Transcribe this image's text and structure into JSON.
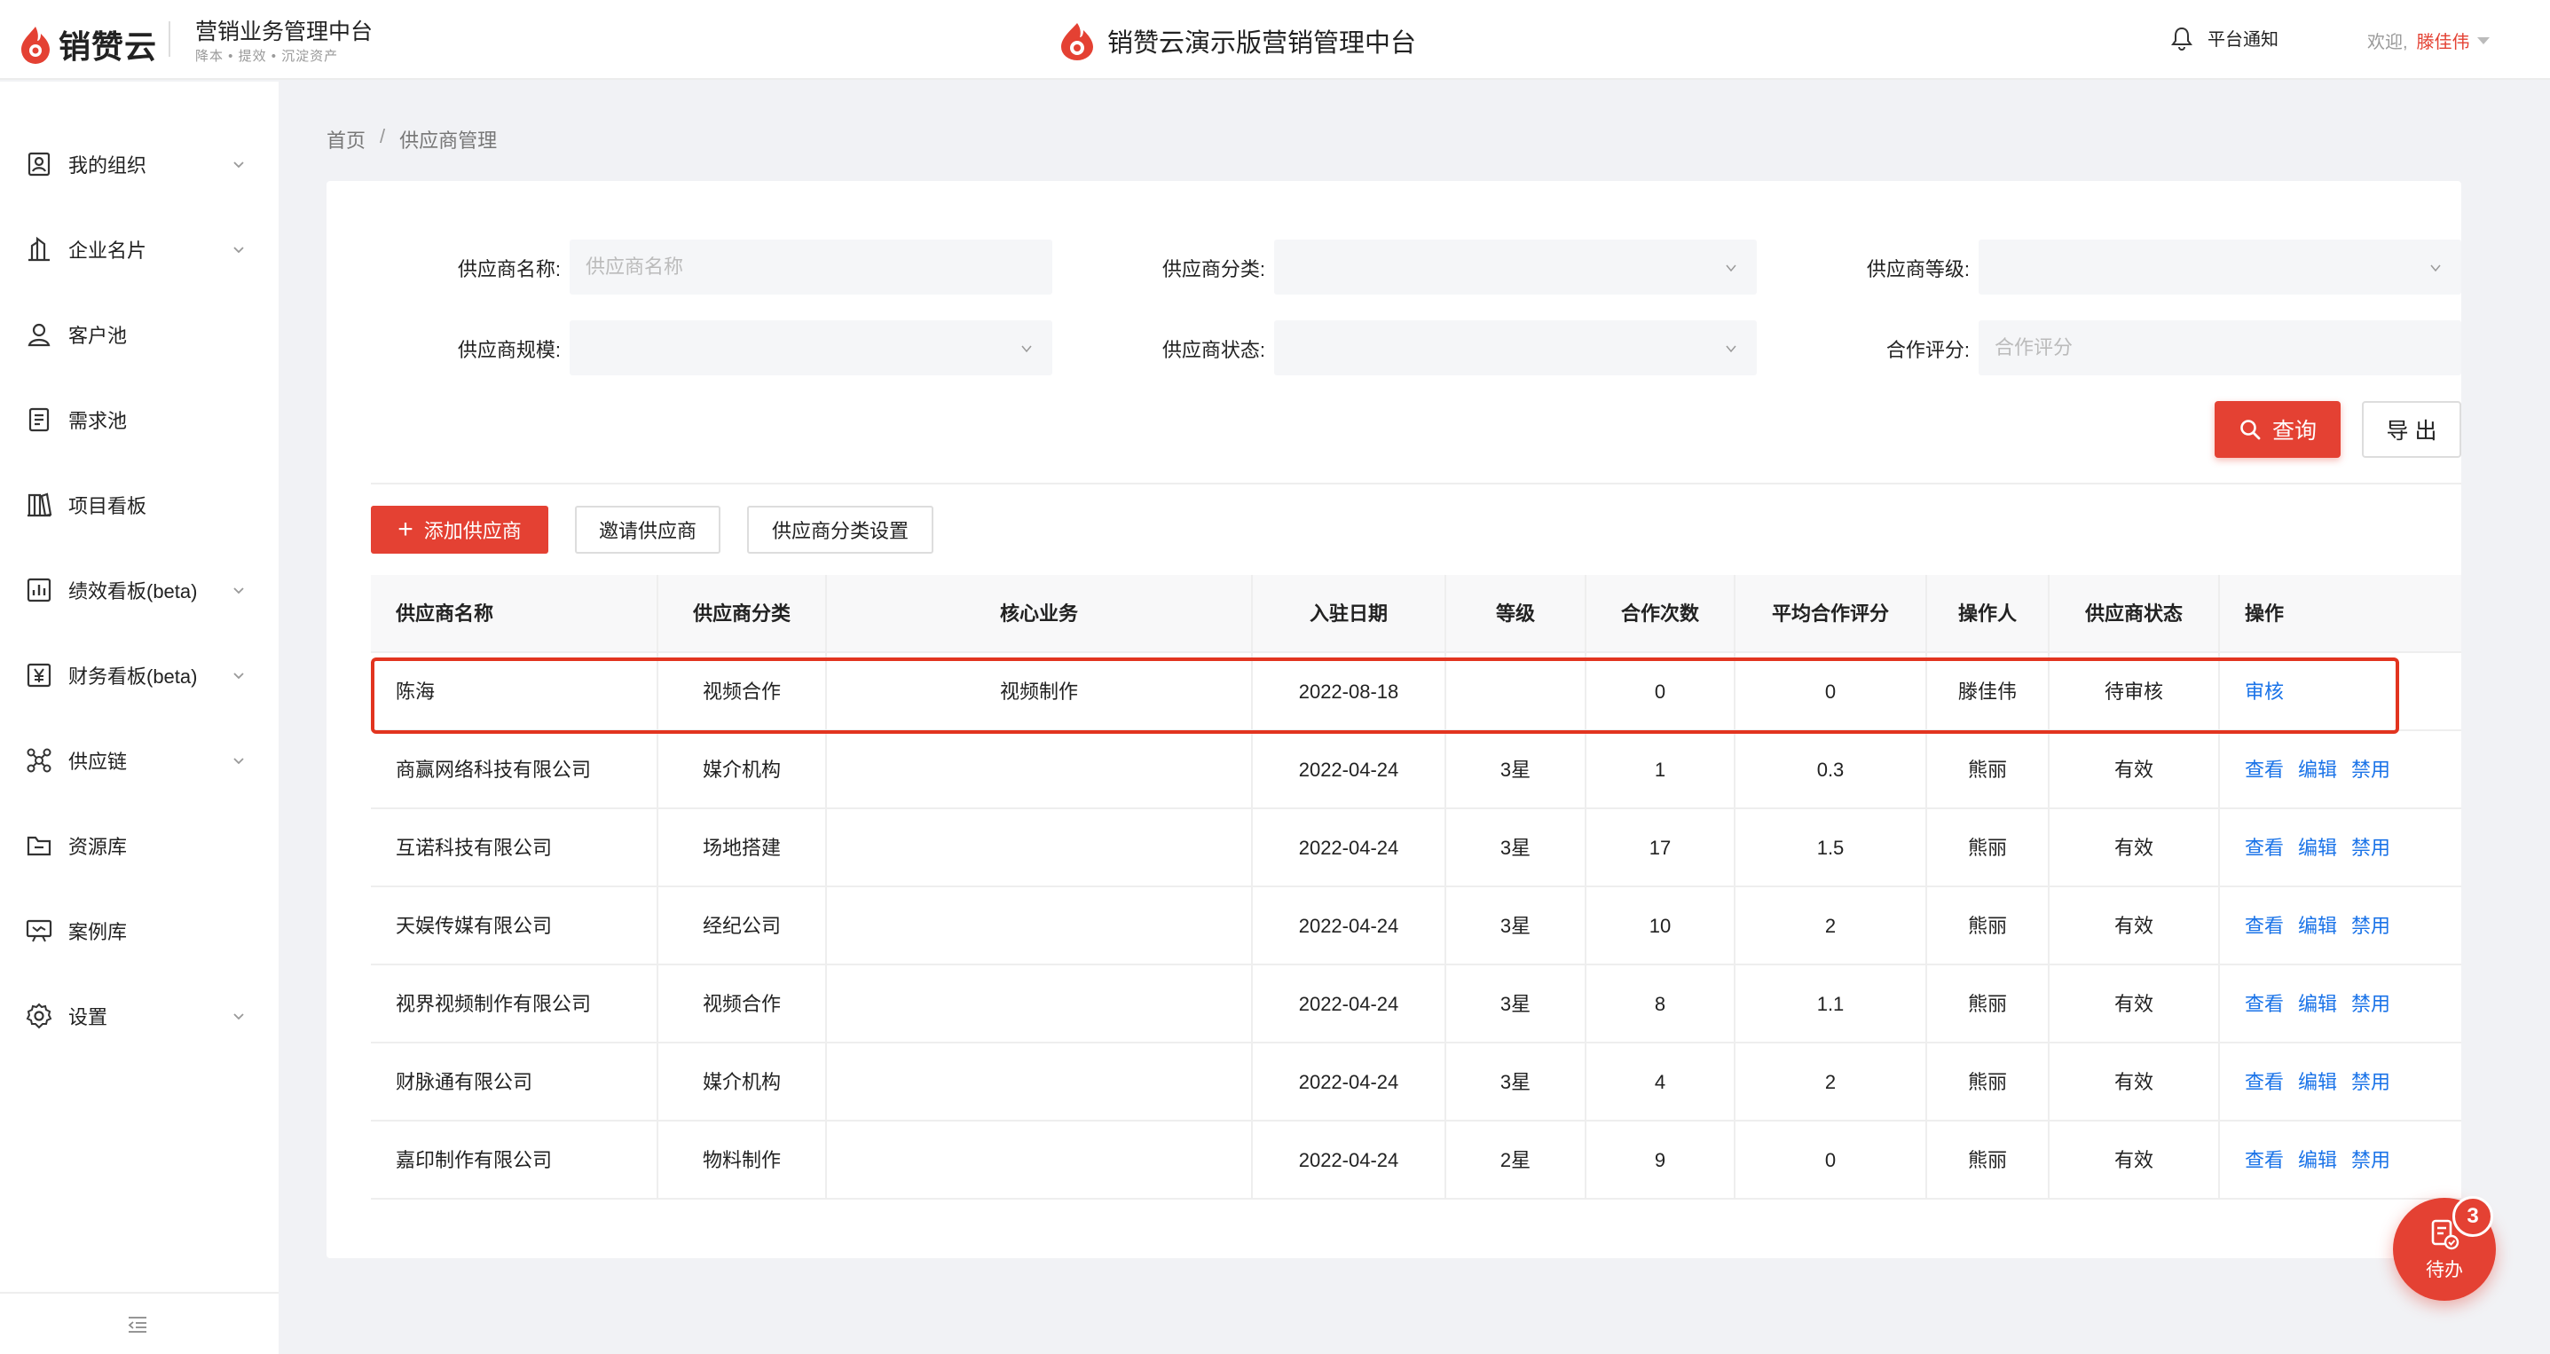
{
  "app": {
    "logo_text": "销赞云",
    "system_title": "营销业务管理中台",
    "system_subtitle": "降本 • 提效 • 沉淀资产",
    "center_title": "销赞云演示版营销管理中台",
    "notice_label": "平台通知",
    "welcome_label": "欢迎,",
    "user_name": "滕佳伟",
    "accent_color": "#e44133",
    "link_color": "#1a73e8"
  },
  "sidebar": {
    "items": [
      {
        "label": "我的组织",
        "icon": "org-icon",
        "has_children": true
      },
      {
        "label": "企业名片",
        "icon": "building-icon",
        "has_children": true
      },
      {
        "label": "客户池",
        "icon": "user-icon",
        "has_children": false
      },
      {
        "label": "需求池",
        "icon": "doc-icon",
        "has_children": false
      },
      {
        "label": "项目看板",
        "icon": "board-icon",
        "has_children": false
      },
      {
        "label": "绩效看板(beta)",
        "icon": "chart-icon",
        "has_children": true
      },
      {
        "label": "财务看板(beta)",
        "icon": "yen-icon",
        "has_children": true
      },
      {
        "label": "供应链",
        "icon": "network-icon",
        "has_children": true
      },
      {
        "label": "资源库",
        "icon": "folder-icon",
        "has_children": false
      },
      {
        "label": "案例库",
        "icon": "presentation-icon",
        "has_children": false
      },
      {
        "label": "设置",
        "icon": "gear-icon",
        "has_children": true
      }
    ]
  },
  "breadcrumb": {
    "home": "首页",
    "separator": "/",
    "current": "供应商管理"
  },
  "filters": {
    "name_label": "供应商名称:",
    "name_placeholder": "供应商名称",
    "category_label": "供应商分类:",
    "level_label": "供应商等级:",
    "scale_label": "供应商规模:",
    "status_label": "供应商状态:",
    "rating_label": "合作评分:",
    "rating_placeholder": "合作评分"
  },
  "actions": {
    "query": "查询",
    "export": "导 出",
    "add": "添加供应商",
    "invite": "邀请供应商",
    "category_settings": "供应商分类设置"
  },
  "table": {
    "columns": [
      "供应商名称",
      "供应商分类",
      "核心业务",
      "入驻日期",
      "等级",
      "合作次数",
      "平均合作评分",
      "操作人",
      "供应商状态",
      "操作"
    ],
    "rows": [
      {
        "name": "陈海",
        "category": "视频合作",
        "core": "视频制作",
        "date": "2022-08-18",
        "level": "",
        "count": "0",
        "score": "0",
        "operator": "滕佳伟",
        "status": "待审核",
        "ops": [
          "审核"
        ]
      },
      {
        "name": "商赢网络科技有限公司",
        "category": "媒介机构",
        "core": "",
        "date": "2022-04-24",
        "level": "3星",
        "count": "1",
        "score": "0.3",
        "operator": "熊丽",
        "status": "有效",
        "ops": [
          "查看",
          "编辑",
          "禁用"
        ]
      },
      {
        "name": "互诺科技有限公司",
        "category": "场地搭建",
        "core": "",
        "date": "2022-04-24",
        "level": "3星",
        "count": "17",
        "score": "1.5",
        "operator": "熊丽",
        "status": "有效",
        "ops": [
          "查看",
          "编辑",
          "禁用"
        ]
      },
      {
        "name": "天娱传媒有限公司",
        "category": "经纪公司",
        "core": "",
        "date": "2022-04-24",
        "level": "3星",
        "count": "10",
        "score": "2",
        "operator": "熊丽",
        "status": "有效",
        "ops": [
          "查看",
          "编辑",
          "禁用"
        ]
      },
      {
        "name": "视界视频制作有限公司",
        "category": "视频合作",
        "core": "",
        "date": "2022-04-24",
        "level": "3星",
        "count": "8",
        "score": "1.1",
        "operator": "熊丽",
        "status": "有效",
        "ops": [
          "查看",
          "编辑",
          "禁用"
        ]
      },
      {
        "name": "财脉通有限公司",
        "category": "媒介机构",
        "core": "",
        "date": "2022-04-24",
        "level": "3星",
        "count": "4",
        "score": "2",
        "operator": "熊丽",
        "status": "有效",
        "ops": [
          "查看",
          "编辑",
          "禁用"
        ]
      },
      {
        "name": "嘉印制作有限公司",
        "category": "物料制作",
        "core": "",
        "date": "2022-04-24",
        "level": "2星",
        "count": "9",
        "score": "0",
        "operator": "熊丽",
        "status": "有效",
        "ops": [
          "查看",
          "编辑",
          "禁用"
        ]
      }
    ]
  },
  "todo": {
    "label": "待办",
    "count": "3"
  }
}
